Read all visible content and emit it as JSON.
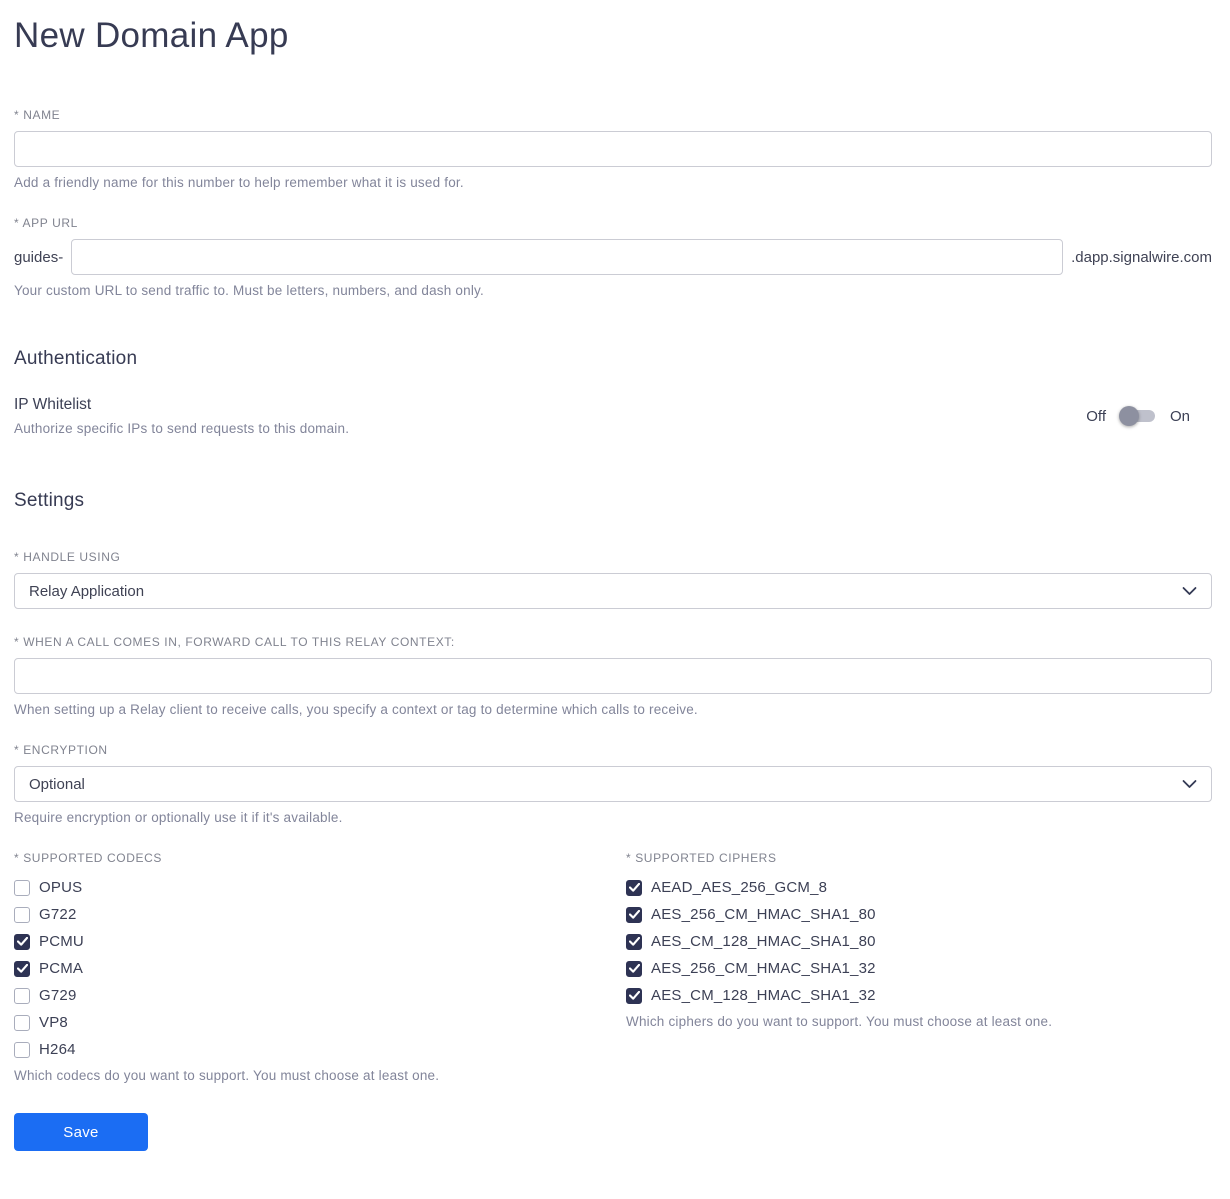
{
  "page": {
    "title": "New Domain App"
  },
  "colors": {
    "accent": "#1b6df3",
    "heading_text": "#373b53",
    "checkbox_checked": "#2e3354",
    "toggle_track": "#bfc1cc",
    "toggle_knob": "#8d90a0"
  },
  "icons": {
    "check_icon": "✓",
    "chevron_down_icon": "⌄"
  },
  "name_field": {
    "label": "* NAME",
    "value": "",
    "help": "Add a friendly name for this number to help remember what it is used for."
  },
  "app_url_field": {
    "label": "* APP URL",
    "prefix": "guides-",
    "value": "",
    "suffix": ".dapp.signalwire.com",
    "help": "Your custom URL to send traffic to. Must be letters, numbers, and dash only."
  },
  "authentication": {
    "heading": "Authentication",
    "ip_whitelist": {
      "label": "IP Whitelist",
      "help": "Authorize specific IPs to send requests to this domain.",
      "off_label": "Off",
      "on_label": "On",
      "state": "off"
    }
  },
  "settings": {
    "heading": "Settings",
    "handle_using": {
      "label": "* HANDLE USING",
      "selected": "Relay Application"
    },
    "relay_context": {
      "label": "* WHEN A CALL COMES IN, FORWARD CALL TO THIS RELAY CONTEXT:",
      "value": "",
      "help": "When setting up a Relay client to receive calls, you specify a context or tag to determine which calls to receive."
    },
    "encryption": {
      "label": "* ENCRYPTION",
      "selected": "Optional",
      "help": "Require encryption or optionally use it if it's available."
    },
    "codecs": {
      "label": "* SUPPORTED CODECS",
      "help": "Which codecs do you want to support. You must choose at least one.",
      "items": [
        {
          "label": "OPUS",
          "checked": false
        },
        {
          "label": "G722",
          "checked": false
        },
        {
          "label": "PCMU",
          "checked": true
        },
        {
          "label": "PCMA",
          "checked": true
        },
        {
          "label": "G729",
          "checked": false
        },
        {
          "label": "VP8",
          "checked": false
        },
        {
          "label": "H264",
          "checked": false
        }
      ]
    },
    "ciphers": {
      "label": "* SUPPORTED CIPHERS",
      "help": "Which ciphers do you want to support. You must choose at least one.",
      "items": [
        {
          "label": "AEAD_AES_256_GCM_8",
          "checked": true
        },
        {
          "label": "AES_256_CM_HMAC_SHA1_80",
          "checked": true
        },
        {
          "label": "AES_CM_128_HMAC_SHA1_80",
          "checked": true
        },
        {
          "label": "AES_256_CM_HMAC_SHA1_32",
          "checked": true
        },
        {
          "label": "AES_CM_128_HMAC_SHA1_32",
          "checked": true
        }
      ]
    }
  },
  "save_button": {
    "label": "Save"
  }
}
